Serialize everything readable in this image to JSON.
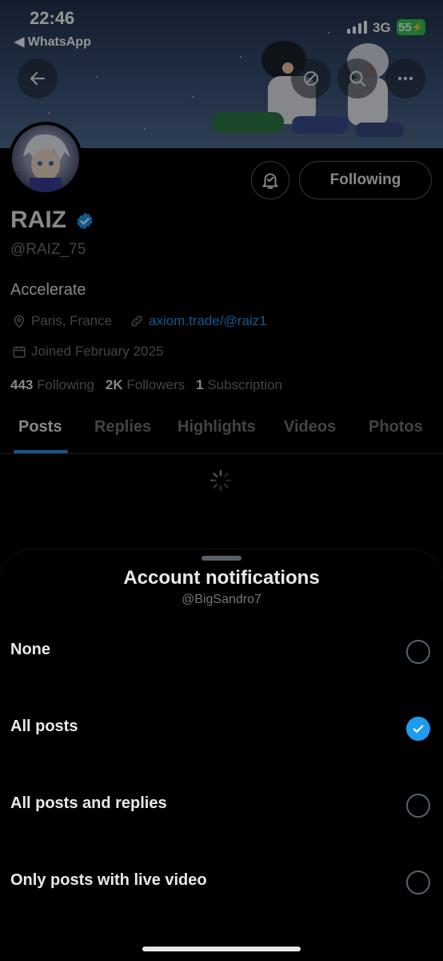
{
  "status_bar": {
    "time": "22:46",
    "back_app": "◀ WhatsApp",
    "network": "3G",
    "battery": "55"
  },
  "profile": {
    "name": "RAIZ",
    "handle": "@RAIZ_75",
    "bio": "Accelerate",
    "location": "Paris, France",
    "website": "axiom.trade/@raiz1",
    "joined": "Joined February 2025",
    "following_button": "Following",
    "stats": {
      "following_count": "443",
      "following_label": "Following",
      "followers_count": "2K",
      "followers_label": "Followers",
      "subscriptions_count": "1",
      "subscriptions_label": "Subscription"
    },
    "tabs": [
      "Posts",
      "Replies",
      "Highlights",
      "Videos",
      "Photos"
    ],
    "active_tab": "Posts"
  },
  "sheet": {
    "title": "Account notifications",
    "subtitle": "@BigSandro7",
    "options": [
      {
        "label": "None",
        "selected": false
      },
      {
        "label": "All posts",
        "selected": true
      },
      {
        "label": "All posts and replies",
        "selected": false
      },
      {
        "label": "Only posts with live video",
        "selected": false
      }
    ]
  },
  "colors": {
    "accent": "#1d9bf0",
    "background": "#000000",
    "muted_text": "#71767b"
  },
  "icons": [
    "back-arrow-icon",
    "feed-icon",
    "search-icon",
    "more-icon",
    "bell-icon",
    "verified-badge-icon",
    "location-icon",
    "link-icon",
    "calendar-icon",
    "loading-spinner-icon",
    "checkmark-icon"
  ]
}
